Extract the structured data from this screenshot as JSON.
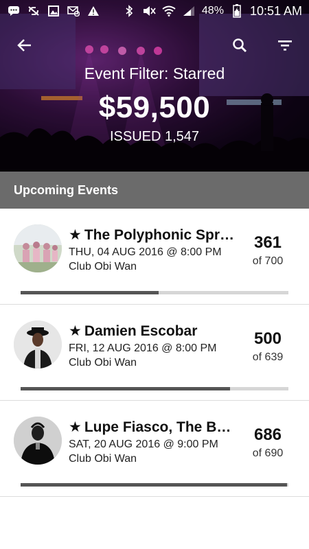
{
  "status_bar": {
    "battery": "48%",
    "time": "10:51 AM"
  },
  "header": {
    "filter_label": "Event Filter: Starred",
    "revenue": "$59,500",
    "issued": "ISSUED 1,547"
  },
  "section": {
    "title": "Upcoming Events"
  },
  "events": [
    {
      "star": "★",
      "title": "The Polyphonic Spr…",
      "date": "THU, 04 AUG 2016 @ 8:00 PM",
      "venue": "Club Obi Wan",
      "sold": "361",
      "capacity": "of 700",
      "progress": 0.515
    },
    {
      "star": "★",
      "title": "Damien Escobar",
      "date": "FRI, 12 AUG 2016 @ 8:00 PM",
      "venue": "Club Obi Wan",
      "sold": "500",
      "capacity": "of 639",
      "progress": 0.782
    },
    {
      "star": "★",
      "title": "Lupe Fiasco, The Bo…",
      "date": "SAT, 20 AUG 2016 @ 9:00 PM",
      "venue": "Club Obi Wan",
      "sold": "686",
      "capacity": "of 690",
      "progress": 0.994
    }
  ],
  "colors": {
    "section_bg": "#6b6b6b",
    "progress_fill": "#555555",
    "progress_track": "#d6d6d6"
  }
}
